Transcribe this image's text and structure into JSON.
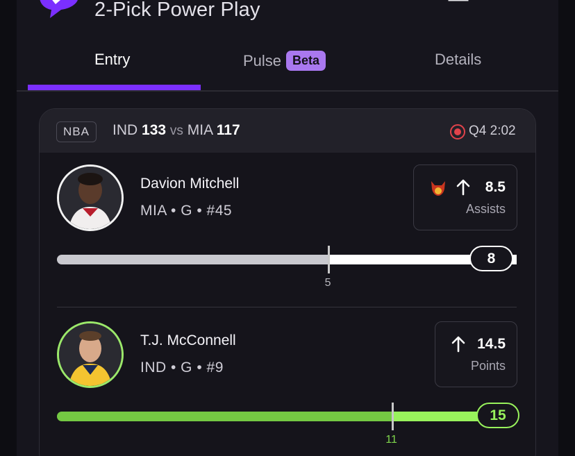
{
  "header": {
    "title": "2-Pick Power Play",
    "brand_color": "#7b2fff"
  },
  "tabs": [
    {
      "label": "Entry",
      "active": true
    },
    {
      "label": "Pulse",
      "badge": "Beta"
    },
    {
      "label": "Details"
    }
  ],
  "game": {
    "league": "NBA",
    "home_team": "IND",
    "home_score": "133",
    "vs": "vs",
    "away_team": "MIA",
    "away_score": "117",
    "clock": "Q4 2:02",
    "live_color": "#e2434b"
  },
  "picks": [
    {
      "name": "Davion Mitchell",
      "info": "MIA • G • #45",
      "line": "8.5",
      "direction": "up",
      "stat": "Assists",
      "has_demon_icon": true,
      "current": "8",
      "marker": "5",
      "progress_fraction": 1.0,
      "marker_fraction": 0.59,
      "bar_color": "#ffffff",
      "base_color": "#c9c9cf"
    },
    {
      "name": "T.J. McConnell",
      "info": "IND • G • #9",
      "line": "14.5",
      "direction": "up",
      "stat": "Points",
      "has_demon_icon": false,
      "current": "15",
      "marker": "11",
      "progress_fraction": 1.0,
      "marker_fraction": 0.73,
      "bar_color": "#98f25c",
      "base_color": "#74c943"
    }
  ]
}
